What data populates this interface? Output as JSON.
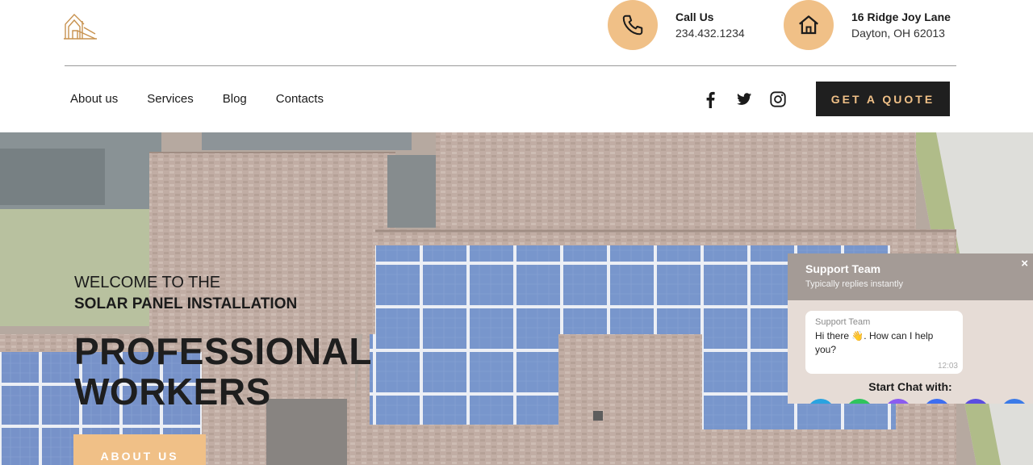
{
  "header": {
    "call": {
      "label": "Call Us",
      "value": "234.432.1234",
      "icon": "phone-icon"
    },
    "address": {
      "line1": "16 Ridge Joy Lane",
      "line2": "Dayton, OH 62013",
      "icon": "home-icon"
    }
  },
  "nav": {
    "links": [
      "About us",
      "Services",
      "Blog",
      "Contacts"
    ],
    "social": [
      "facebook-icon",
      "twitter-icon",
      "instagram-icon"
    ],
    "quote_label": "GET A QUOTE"
  },
  "hero": {
    "welcome": "WELCOME TO THE",
    "subtitle": "SOLAR PANEL INSTALLATION",
    "headline_line1": "PROFESSIONAL",
    "headline_line2": "WORKERS",
    "button_label": "ABOUT US"
  },
  "chat": {
    "title": "Support Team",
    "subtitle": "Typically replies instantly",
    "close": "×",
    "message": {
      "sender": "Support Team",
      "text": "Hi there 👋. How can I help you?",
      "time": "12:03"
    },
    "start_label": "Start Chat with:",
    "channel_colors": [
      "#2aa3e0",
      "#2ec45c",
      "#8a5cf0",
      "#3d6ef0",
      "#5b4de0",
      "#3b7be8"
    ]
  },
  "colors": {
    "accent": "#f0c087",
    "dark": "#1f1f1f"
  }
}
